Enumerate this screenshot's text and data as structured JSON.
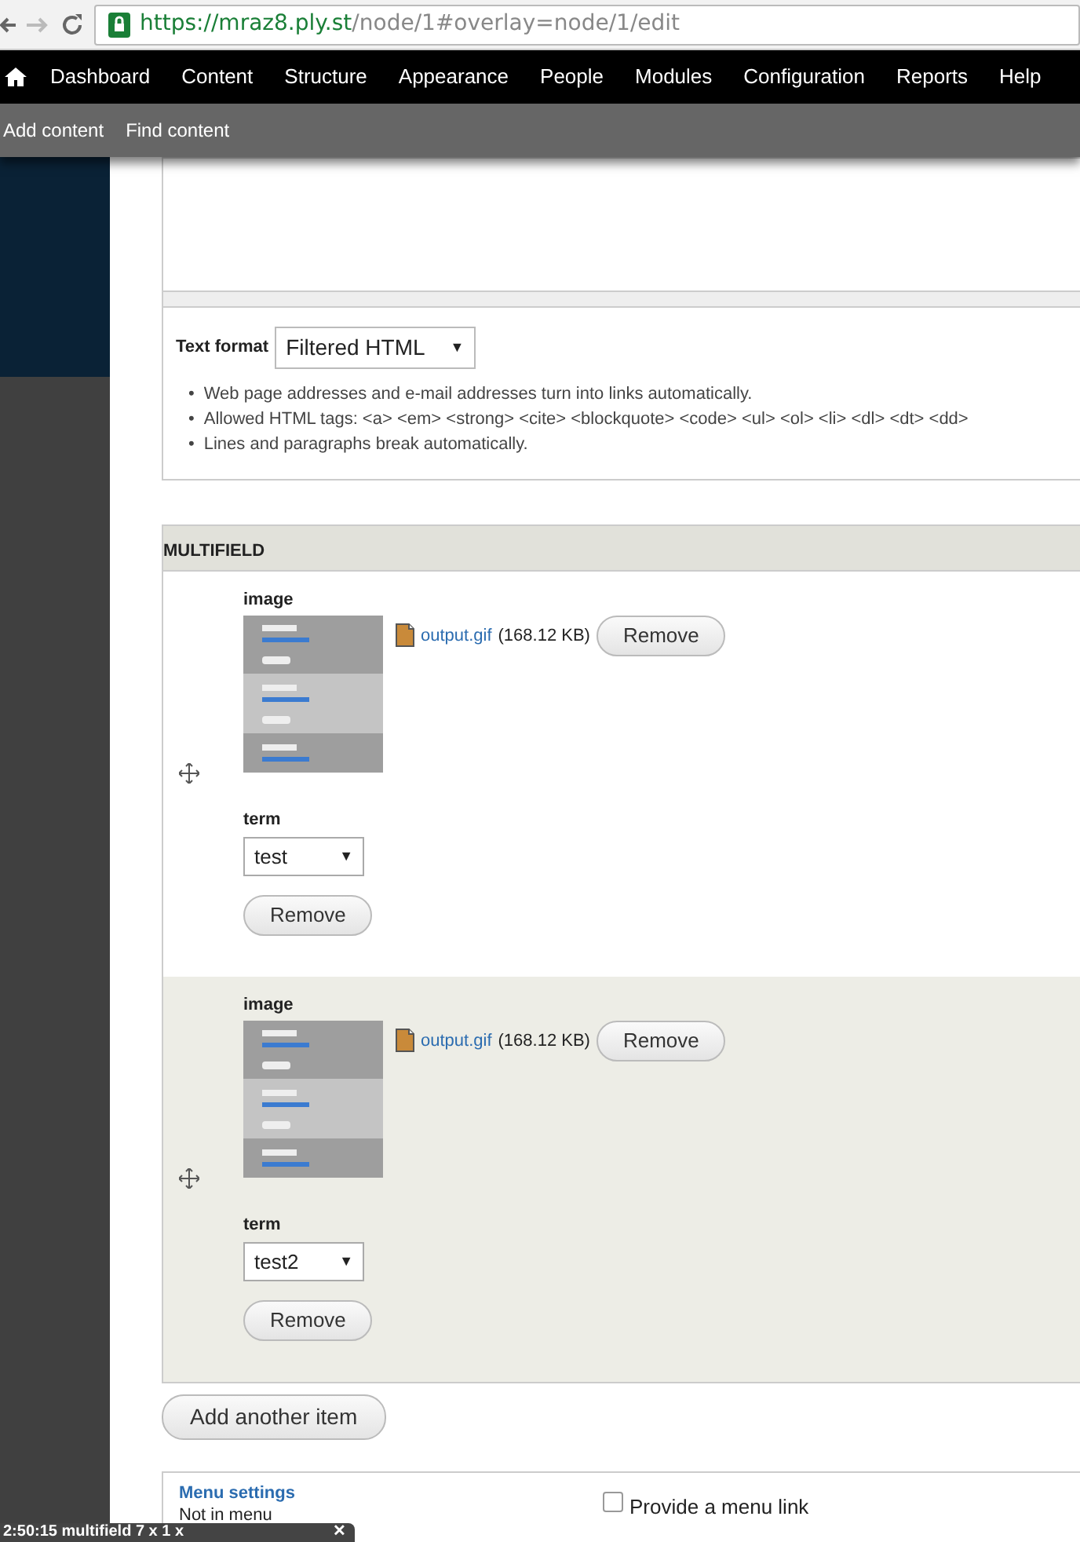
{
  "browser": {
    "secure": true,
    "url_host": "https://mraz8.ply.st",
    "url_path": "/node/1#overlay=node/1/edit"
  },
  "toolbar": {
    "menu": [
      "Dashboard",
      "Content",
      "Structure",
      "Appearance",
      "People",
      "Modules",
      "Configuration",
      "Reports",
      "Help"
    ]
  },
  "shortcuts": [
    "Add content",
    "Find content"
  ],
  "text_format": {
    "label": "Text format",
    "value": "Filtered HTML",
    "caret": "▼",
    "tips": [
      {
        "bullet": "•",
        "text": "Web page addresses and e-mail addresses turn into links automatically."
      },
      {
        "bullet": "•",
        "text": "Allowed HTML tags: <a> <em> <strong> <cite> <blockquote> <code> <ul> <ol> <li> <dl> <dt> <dd>"
      },
      {
        "bullet": "•",
        "text": "Lines and paragraphs break automatically."
      }
    ]
  },
  "multifield": {
    "title": "MULTIFIELD",
    "items": [
      {
        "striped": false,
        "image_label": "image",
        "file_name": "output.gif",
        "file_size": "(168.12 KB)",
        "remove_file": "Remove",
        "term_label": "term",
        "term": "test",
        "term_caret": "▼",
        "remove_item": "Remove"
      },
      {
        "striped": true,
        "image_label": "image",
        "file_name": "output.gif",
        "file_size": "(168.12 KB)",
        "remove_file": "Remove",
        "term_label": "term",
        "term": "test2",
        "term_caret": "▼",
        "remove_item": "Remove"
      }
    ],
    "add_button": "Add another item"
  },
  "menu_settings": {
    "title": "Menu settings",
    "summary": "Not in menu",
    "checkbox": {
      "label": "Provide a menu link",
      "checked": false
    }
  },
  "overlay_bar": {
    "text": "2:50:15   multifield 7 x 1 x",
    "close": "✕"
  }
}
